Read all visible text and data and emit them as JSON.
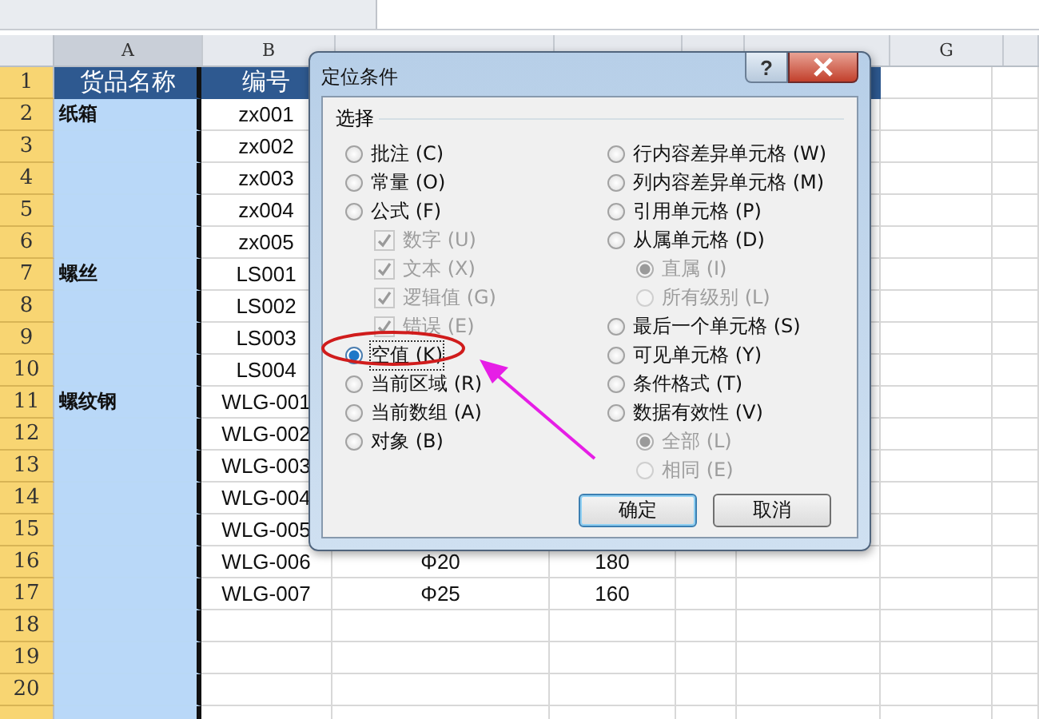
{
  "sheet": {
    "columns": [
      {
        "label": "A",
        "selected": true
      },
      {
        "label": "B",
        "selected": false
      },
      {
        "selected": false
      },
      {
        "selected": false
      },
      {
        "selected": false
      },
      {
        "selected": false
      },
      {
        "label": "G",
        "selected": false
      }
    ],
    "rows": [
      {
        "number": "1",
        "header": true,
        "a": "货品名称",
        "b": "编号"
      },
      {
        "number": "2",
        "header": false,
        "a": "纸箱",
        "b": "zx001"
      },
      {
        "number": "3",
        "header": false,
        "b": "zx002"
      },
      {
        "number": "4",
        "header": false,
        "b": "zx003"
      },
      {
        "number": "5",
        "header": false,
        "b": "zx004"
      },
      {
        "number": "6",
        "header": false,
        "b": "zx005"
      },
      {
        "number": "7",
        "header": false,
        "a": "螺丝",
        "b": "LS001"
      },
      {
        "number": "8",
        "header": false,
        "b": "LS002"
      },
      {
        "number": "9",
        "header": false,
        "b": "LS003"
      },
      {
        "number": "10",
        "header": false,
        "b": "LS004"
      },
      {
        "number": "11",
        "header": false,
        "a": "螺纹钢",
        "b": "WLG-001"
      },
      {
        "number": "12",
        "header": false,
        "b": "WLG-002"
      },
      {
        "number": "13",
        "header": false,
        "b": "WLG-003"
      },
      {
        "number": "14",
        "header": false,
        "b": "WLG-004"
      },
      {
        "number": "15",
        "header": false,
        "b": "WLG-005"
      },
      {
        "number": "16",
        "header": false,
        "b": "WLG-006",
        "c": "Φ20",
        "d": "180"
      },
      {
        "number": "17",
        "header": false,
        "b": "WLG-007",
        "c": "Φ25",
        "d": "160"
      },
      {
        "number": "18",
        "header": false
      },
      {
        "number": "19",
        "header": false
      },
      {
        "number": "20",
        "header": false
      },
      {
        "header": false
      }
    ]
  },
  "dialog": {
    "title": "定位条件",
    "help": "?",
    "group_label": "选择",
    "left_options": [
      {
        "kind": "radio",
        "label": "批注 (C)",
        "selected": false,
        "disabled": false
      },
      {
        "kind": "radio",
        "label": "常量 (O)",
        "selected": false,
        "disabled": false
      },
      {
        "kind": "radio",
        "label": "公式 (F)",
        "selected": false,
        "disabled": false,
        "children": [
          {
            "kind": "checkbox",
            "label": "数字 (U)",
            "checked": true,
            "disabled": true
          },
          {
            "kind": "checkbox",
            "label": "文本 (X)",
            "checked": true,
            "disabled": true
          },
          {
            "kind": "checkbox",
            "label": "逻辑值 (G)",
            "checked": true,
            "disabled": true
          },
          {
            "kind": "checkbox",
            "label": "错误 (E)",
            "checked": true,
            "disabled": true
          }
        ]
      },
      {
        "kind": "radio",
        "label": "空值 (K)",
        "selected": true,
        "disabled": false
      },
      {
        "kind": "radio",
        "label": "当前区域 (R)",
        "selected": false,
        "disabled": false
      },
      {
        "kind": "radio",
        "label": "当前数组 (A)",
        "selected": false,
        "disabled": false
      },
      {
        "kind": "radio",
        "label": "对象 (B)",
        "selected": false,
        "disabled": false
      }
    ],
    "right_options": [
      {
        "kind": "radio",
        "label": "行内容差异单元格 (W)",
        "selected": false,
        "disabled": false
      },
      {
        "kind": "radio",
        "label": "列内容差异单元格 (M)",
        "selected": false,
        "disabled": false
      },
      {
        "kind": "radio",
        "label": "引用单元格 (P)",
        "selected": false,
        "disabled": false
      },
      {
        "kind": "radio",
        "label": "从属单元格 (D)",
        "selected": false,
        "disabled": false,
        "children": [
          {
            "kind": "radio",
            "label": "直属 (I)",
            "selected": true,
            "disabled": true
          },
          {
            "kind": "radio",
            "label": "所有级别 (L)",
            "selected": false,
            "disabled": true
          }
        ]
      },
      {
        "kind": "radio",
        "label": "最后一个单元格 (S)",
        "selected": false,
        "disabled": false
      },
      {
        "kind": "radio",
        "label": "可见单元格 (Y)",
        "selected": false,
        "disabled": false
      },
      {
        "kind": "radio",
        "label": "条件格式 (T)",
        "selected": false,
        "disabled": false
      },
      {
        "kind": "radio",
        "label": "数据有效性 (V)",
        "selected": false,
        "disabled": false,
        "children": [
          {
            "kind": "radio",
            "label": "全部 (L)",
            "selected": true,
            "disabled": true
          },
          {
            "kind": "radio",
            "label": "相同 (E)",
            "selected": false,
            "disabled": true
          }
        ]
      }
    ],
    "buttons": [
      {
        "label": "确定",
        "default": true
      },
      {
        "label": "取消",
        "default": false
      }
    ]
  }
}
